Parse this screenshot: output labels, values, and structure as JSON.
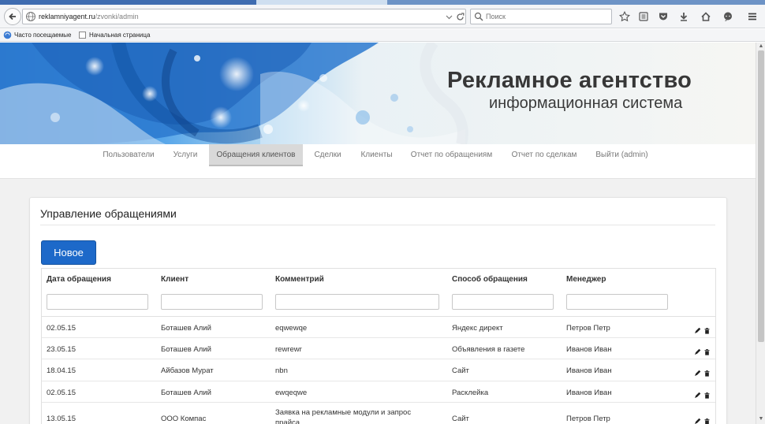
{
  "browser": {
    "url_domain": "reklamniyagent.ru",
    "url_path": "/zvonki/admin",
    "search_placeholder": "Поиск",
    "bookmarks": [
      "Часто посещаемые",
      "Начальная страница"
    ]
  },
  "site": {
    "title": "Рекламное агентство",
    "subtitle": "информационная система"
  },
  "menu": {
    "items": [
      {
        "label": "Пользователи",
        "active": false
      },
      {
        "label": "Услуги",
        "active": false
      },
      {
        "label": "Обращения клиентов",
        "active": true
      },
      {
        "label": "Сделки",
        "active": false
      },
      {
        "label": "Клиенты",
        "active": false
      },
      {
        "label": "Отчет по обращениям",
        "active": false
      },
      {
        "label": "Отчет по сделкам",
        "active": false
      },
      {
        "label": "Выйти (admin)",
        "active": false
      }
    ]
  },
  "panel": {
    "title": "Управление обращениями",
    "new_button": "Новое"
  },
  "table": {
    "columns": [
      "Дата обращения",
      "Клиент",
      "Комментрий",
      "Способ обращения",
      "Менеджер"
    ],
    "rows": [
      {
        "date": "02.05.15",
        "client": "Боташев Алий",
        "comment": "eqwewqe",
        "method": "Яндекс директ",
        "manager": "Петров Петр"
      },
      {
        "date": "23.05.15",
        "client": "Боташев Алий",
        "comment": "rewrewr",
        "method": "Объявления в газете",
        "manager": "Иванов Иван"
      },
      {
        "date": "18.04.15",
        "client": "Айбазов Мурат",
        "comment": "nbn",
        "method": "Сайт",
        "manager": "Иванов Иван"
      },
      {
        "date": "02.05.15",
        "client": "Боташев Алий",
        "comment": "ewqeqwe",
        "method": "Расклейка",
        "manager": "Иванов Иван"
      },
      {
        "date": "13.05.15",
        "client": "ООО Компас",
        "comment": "Заявка на рекламные модули и запрос прайса",
        "method": "Сайт",
        "manager": "Петров Петр"
      }
    ]
  },
  "colors": {
    "accent": "#1d69c9",
    "active_menu_bg": "#d9d9d9"
  }
}
